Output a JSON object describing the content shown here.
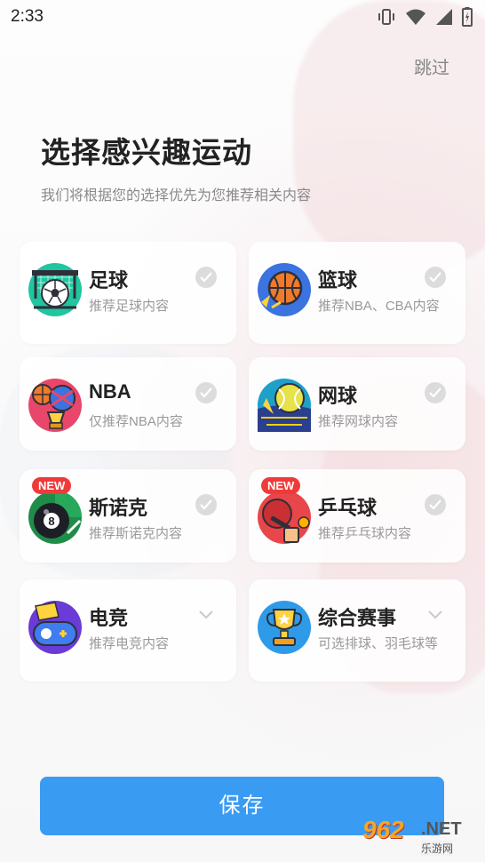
{
  "status_bar": {
    "time": "2:33"
  },
  "header": {
    "skip_label": "跳过",
    "title": "选择感兴趣运动",
    "subtitle": "我们将根据您的选择优先为您推荐相关内容"
  },
  "sports": [
    {
      "name": "足球",
      "desc": "推荐足球内容",
      "badge": ""
    },
    {
      "name": "篮球",
      "desc": "推荐NBA、CBA内容",
      "badge": ""
    },
    {
      "name": "NBA",
      "desc": "仅推荐NBA内容",
      "badge": ""
    },
    {
      "name": "网球",
      "desc": "推荐网球内容",
      "badge": ""
    },
    {
      "name": "斯诺克",
      "desc": "推荐斯诺克内容",
      "badge": "NEW"
    },
    {
      "name": "乒乓球",
      "desc": "推荐乒乓球内容",
      "badge": "NEW"
    },
    {
      "name": "电竞",
      "desc": "推荐电竞内容",
      "badge": ""
    },
    {
      "name": "综合赛事",
      "desc": "可选排球、羽毛球等",
      "badge": ""
    }
  ],
  "icons": {
    "football": "football-icon",
    "basketball": "basketball-icon",
    "nba": "nba-icon",
    "tennis": "tennis-icon",
    "snooker": "snooker-8ball-icon",
    "pingpong": "ping-pong-icon",
    "esports": "gamepad-icon",
    "other": "trophy-icon"
  },
  "footer": {
    "save_label": "保存"
  },
  "watermark": {
    "number": "962",
    "domain": ".NET",
    "cn": "乐游网"
  },
  "colors": {
    "accent": "#3a9bf3",
    "badge": "#ef3a3a",
    "check": "#dcdcdc"
  }
}
